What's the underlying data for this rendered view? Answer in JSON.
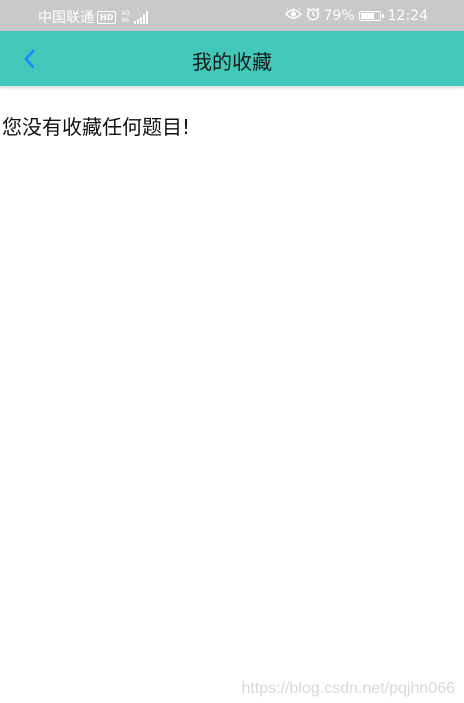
{
  "status_bar": {
    "carrier": "中国联通",
    "hd_badge": "HD",
    "network_type_top": "4G",
    "network_type_bottom": "46",
    "battery_percent": "79%",
    "battery_level": 0.79,
    "time": "12:24",
    "icons": [
      "eye-icon",
      "alarm-icon",
      "battery-icon",
      "signal-icon"
    ]
  },
  "app_bar": {
    "title": "我的收藏",
    "back_icon": "chevron-left-icon",
    "color": "#41c8b8",
    "back_icon_color": "#1a8cff"
  },
  "content": {
    "empty_message": "您没有收藏任何题目!"
  },
  "watermark": {
    "text": "https://blog.csdn.net/pqjhn066"
  }
}
